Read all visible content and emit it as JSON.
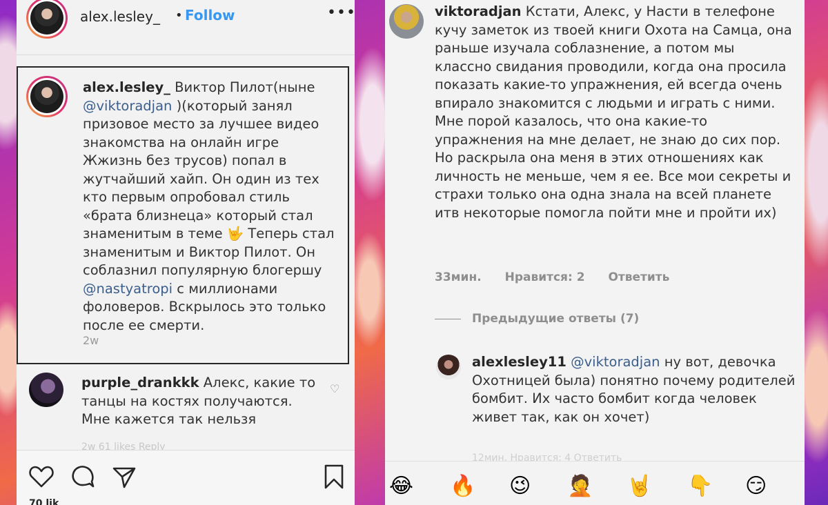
{
  "left": {
    "header": {
      "username": "alex.lesley_",
      "dot": "•",
      "follow_label": "Follow",
      "more_label": "•••"
    },
    "caption": {
      "username": "alex.lesley_",
      "part1": " Виктор Пилот(ныне ",
      "mention1": "@viktoradjan",
      "part2": " )(который занял призовое место за лучшее видео знакомства на онлайн игре Жжизнь без трусов) попал в жутчайший хайп. Он один из тех кто первым опробовал стиль «брата близнеца» который стал знаменитым в теме 🤟 Теперь стал знаменитым и Виктор Пилот. Он соблазнил популярную блогершу ",
      "mention2": "@nastyatropi",
      "part3": " с миллионами фоловеров. Вскрылось это только после ее смерти.",
      "ago": "2w"
    },
    "comment": {
      "username": "purple_drankkk",
      "text": " Алекс, какие то танцы на костях получаются. Мне кажется так нельзя"
    },
    "faded_meta": "2w   61 likes   Reply",
    "likes": "70 lik"
  },
  "right": {
    "comment1": {
      "username": "viktoradjan",
      "text": " Кстати, Алекс, у Насти в телефоне кучу заметок из твоей книги Охота на Самца, она раньше изучала соблазнение, а потом мы классно свидания проводили, когда она просила показать какие-то упражнения, ей всегда очень впирало знакомится с людьми и играть с ними. Мне порой казалось, что она какие-то упражнения на мне делает, не знаю до сих пор. Но раскрыла она меня в этих отношениях как личность не меньше, чем я ее. Все мои секреты и страхи только она одна знала на всей планете итв некоторые помогла пойти мне и пройти их)",
      "time": "33мин.",
      "likes": "Нравится: 2",
      "reply": "Ответить"
    },
    "previous_replies": "Предыдущие ответы (7)",
    "reply": {
      "username": "alexlesley11",
      "mention": "@viktoradjan",
      "text": " ну вот, девочка Охотницей была) понятно почему родителей бомбит. Их часто бомбит когда человек живет так, как он хочет)"
    },
    "faded_meta": "12мин.   Нравится: 4   Ответить",
    "emojis": [
      "😂",
      "🔥",
      "😉",
      "🤦",
      "🤘",
      "👇",
      "😏"
    ]
  }
}
